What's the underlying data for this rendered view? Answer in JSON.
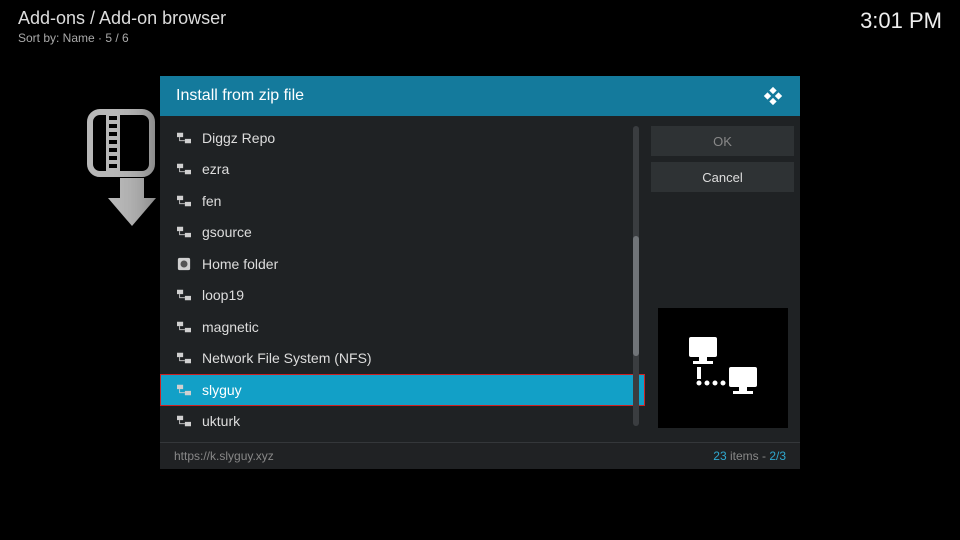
{
  "header": {
    "breadcrumb": "Add-ons / Add-on browser",
    "sort": "Sort by: Name  ·  5 / 6",
    "clock": "3:01 PM"
  },
  "dialog": {
    "title": "Install from zip file",
    "buttons": {
      "ok": "OK",
      "cancel": "Cancel"
    },
    "items": [
      {
        "label": "Diggz Repo",
        "icon": "net"
      },
      {
        "label": "ezra",
        "icon": "net"
      },
      {
        "label": "fen",
        "icon": "net"
      },
      {
        "label": "gsource",
        "icon": "net"
      },
      {
        "label": "Home folder",
        "icon": "disk"
      },
      {
        "label": "loop19",
        "icon": "net"
      },
      {
        "label": "magnetic",
        "icon": "net"
      },
      {
        "label": "Network File System (NFS)",
        "icon": "net"
      },
      {
        "label": "slyguy",
        "icon": "net",
        "selected": true
      },
      {
        "label": "ukturk",
        "icon": "net"
      }
    ],
    "footer": {
      "path": "https://k.slyguy.xyz",
      "count_total": "23",
      "count_label": " items - ",
      "page": "2/3"
    }
  }
}
